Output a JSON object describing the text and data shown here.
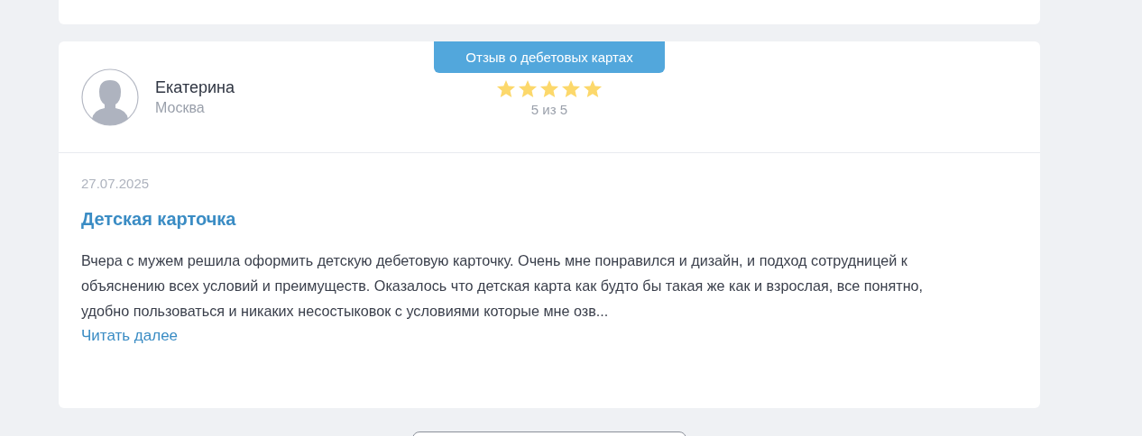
{
  "review": {
    "tag": "Отзыв о дебетовых картах",
    "author": "Екатерина",
    "city": "Москва",
    "stars": 5,
    "rating_text": "5 из 5",
    "date": "27.07.2025",
    "title": "Детская карточка",
    "text": "Вчера с мужем решила оформить детскую дебетовую карточку. Очень мне понравился и дизайн, и подход сотрудницей к объяснению всех условий и преимуществ. Оказалось что детская карта как будто бы такая же как и взрослая, все понятно, удобно пользоваться и никаких несостыковок с условиями которые мне озв...",
    "read_more": "Читать далее"
  }
}
